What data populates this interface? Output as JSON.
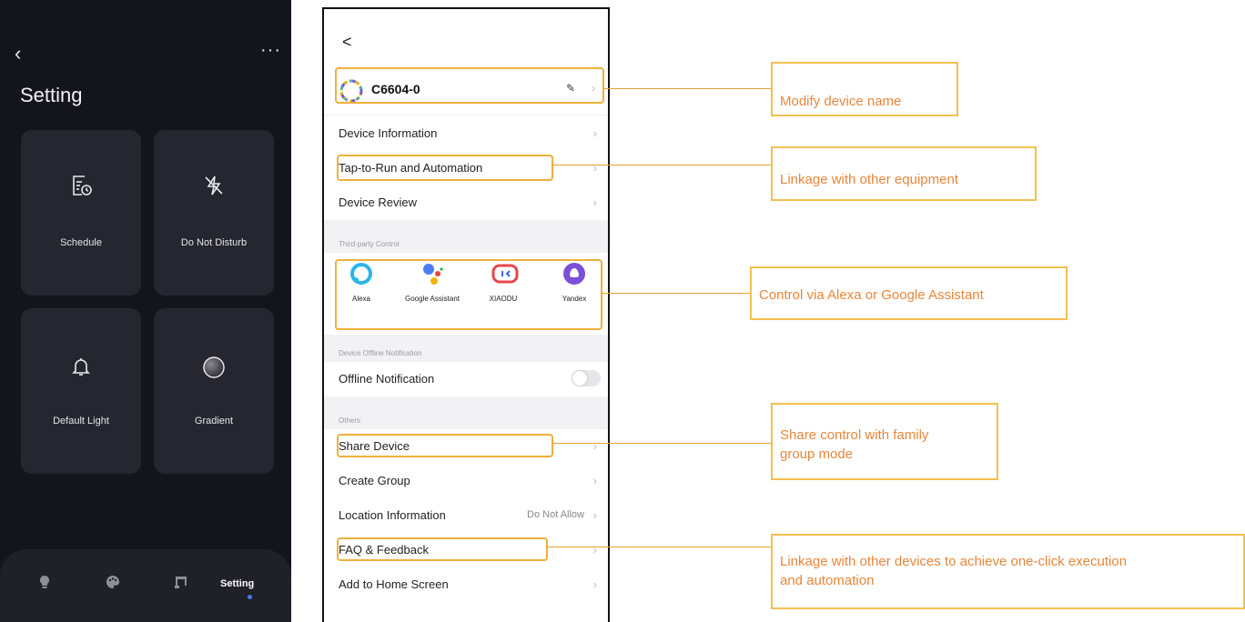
{
  "left_phone": {
    "back_glyph": "‹",
    "more_glyph": "···",
    "title": "Setting",
    "tiles": [
      {
        "label": "Schedule",
        "icon": "schedule-icon"
      },
      {
        "label": "Do Not Disturb",
        "icon": "do-not-disturb-icon"
      },
      {
        "label": "Default Light",
        "icon": "bell-icon"
      },
      {
        "label": "Gradient",
        "icon": "gradient-circle-icon"
      }
    ],
    "tabbar": {
      "items": [
        "bulb-icon",
        "palette-icon",
        "music-icon"
      ],
      "active_label": "Setting"
    }
  },
  "mid_phone": {
    "back_glyph": "<",
    "device_name": "C6604-0",
    "rows": {
      "device_information": "Device Information",
      "tap_to_run": "Tap-to-Run and Automation",
      "device_review": "Device Review",
      "offline_notification": "Offline Notification",
      "share_device": "Share Device",
      "create_group": "Create Group",
      "location_information": "Location Information",
      "location_value": "Do Not Allow",
      "faq_feedback": "FAQ & Feedback",
      "add_to_home": "Add to Home Screen"
    },
    "sections": {
      "third_party": "Third-party Control",
      "offline": "Device Offline Notification",
      "others": "Others"
    },
    "assistants": [
      {
        "label": "Alexa"
      },
      {
        "label": "Google Assistant"
      },
      {
        "label": "XIAODU"
      },
      {
        "label": "Yandex"
      }
    ],
    "offline_toggle_on": false
  },
  "callouts": {
    "modify_name": "Modify device name",
    "linkage_equipment": "Linkage with other equipment",
    "control_alexa": "Control via Alexa or Google Assistant",
    "share_control_1": "Share control with family",
    "share_control_2": "group mode",
    "linkage_devices_1": "Linkage with other devices to achieve one-click execution",
    "linkage_devices_2": "and automation"
  },
  "colors": {
    "highlight": "#f0b03a",
    "callout_text": "#e8863a",
    "dark_bg": "#14141c",
    "tile_bg": "#252630",
    "active_dot": "#4a7cf2"
  }
}
